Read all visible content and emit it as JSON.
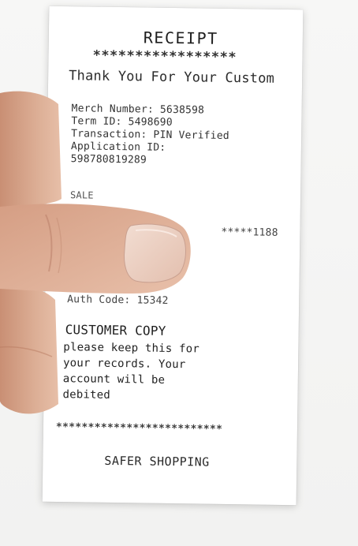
{
  "receipt": {
    "title": "RECEIPT",
    "stars_top": "*****************",
    "thanks": "Thank You For Your Custom",
    "info_lines": [
      "Merch Number: 5638598",
      "Term ID: 5498690",
      "Transaction: PIN Verified",
      "Application ID:",
      "598780819289"
    ],
    "sale": "SALE",
    "card_tail": "*****1188",
    "auth": "Auth Code: 15342",
    "copy_title": "CUSTOMER COPY",
    "copy_lines": [
      "please keep this for",
      "your records. Your",
      "account will be",
      "debited"
    ],
    "stars_bottom": "**************************",
    "footer": "SAFER SHOPPING"
  },
  "colors": {
    "background": "#f4f4f3",
    "paper": "#ffffff",
    "ink": "#2a2a2a",
    "skin": "#d9a88e"
  }
}
